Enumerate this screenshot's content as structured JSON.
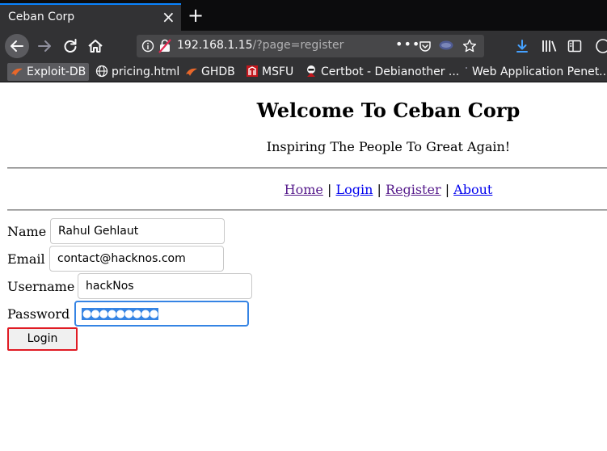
{
  "browser": {
    "tab_title": "Ceban Corp",
    "tab_close": "×",
    "new_tab": "+",
    "url_host": "192.168.1.15",
    "url_path": "/?page=register",
    "url_more": "•••",
    "bookmarks": [
      {
        "label": "Exploit-DB",
        "icon": "exploitdb-icon"
      },
      {
        "label": "pricing.html",
        "icon": "globe-icon"
      },
      {
        "label": "GHDB",
        "icon": "ghdb-icon"
      },
      {
        "label": "MSFU",
        "icon": "msfu-icon"
      },
      {
        "label": "Certbot - Debianother ...",
        "icon": "certbot-icon"
      },
      {
        "label": "Web Application Penet...",
        "icon": "dot-icon"
      }
    ],
    "accent": "#0a84ff"
  },
  "page": {
    "title": "Welcome To Ceban Corp",
    "subtitle": "Inspiring The People To Great Again!",
    "nav": {
      "home": "Home",
      "login": "Login",
      "register": "Register",
      "about": "About",
      "separator": "|"
    },
    "form": {
      "name_label": "Name",
      "name_value": "Rahul Gehlaut",
      "email_label": "Email",
      "email_value": "contact@hacknos.com",
      "username_label": "Username",
      "username_value": "hackNos",
      "password_label": "Password",
      "password_value": "●●●●●●●●●",
      "submit_label": "Login"
    }
  }
}
